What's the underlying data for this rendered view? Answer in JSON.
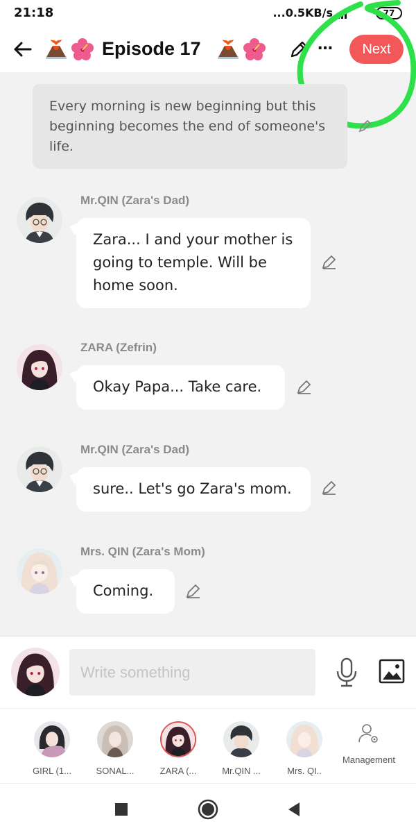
{
  "status": {
    "time": "21:18",
    "network": "...0.5KB/s",
    "battery": "77"
  },
  "header": {
    "title": "Episode 17",
    "next_label": "Next",
    "more_label": "…"
  },
  "narration": {
    "text": "Every morning is new beginning but this beginning becomes the end of someone's life."
  },
  "messages": [
    {
      "name": "Mr.QIN (Zara's Dad)",
      "text": "Zara... I and your mother is going to temple. Will be home soon."
    },
    {
      "name": "ZARA (Zefrin)",
      "text": "Okay Papa... Take care."
    },
    {
      "name": "Mr.QIN (Zara's Dad)",
      "text": "sure.. Let's go Zara's mom."
    },
    {
      "name": "Mrs. QIN (Zara's Mom)",
      "text": "Coming."
    }
  ],
  "composer": {
    "placeholder": "Write something",
    "value": ""
  },
  "characters": [
    {
      "label": "GIRL (1...",
      "active": false
    },
    {
      "label": "SONAL...",
      "active": false
    },
    {
      "label": "ZARA (...",
      "active": true
    },
    {
      "label": "Mr.QIN ...",
      "active": false
    },
    {
      "label": "Mrs. QI..",
      "active": false
    }
  ],
  "management_label": "Management",
  "colors": {
    "next_button": "#f2575a",
    "scribble": "#2ee04a",
    "active_character_ring": "#e05050"
  }
}
